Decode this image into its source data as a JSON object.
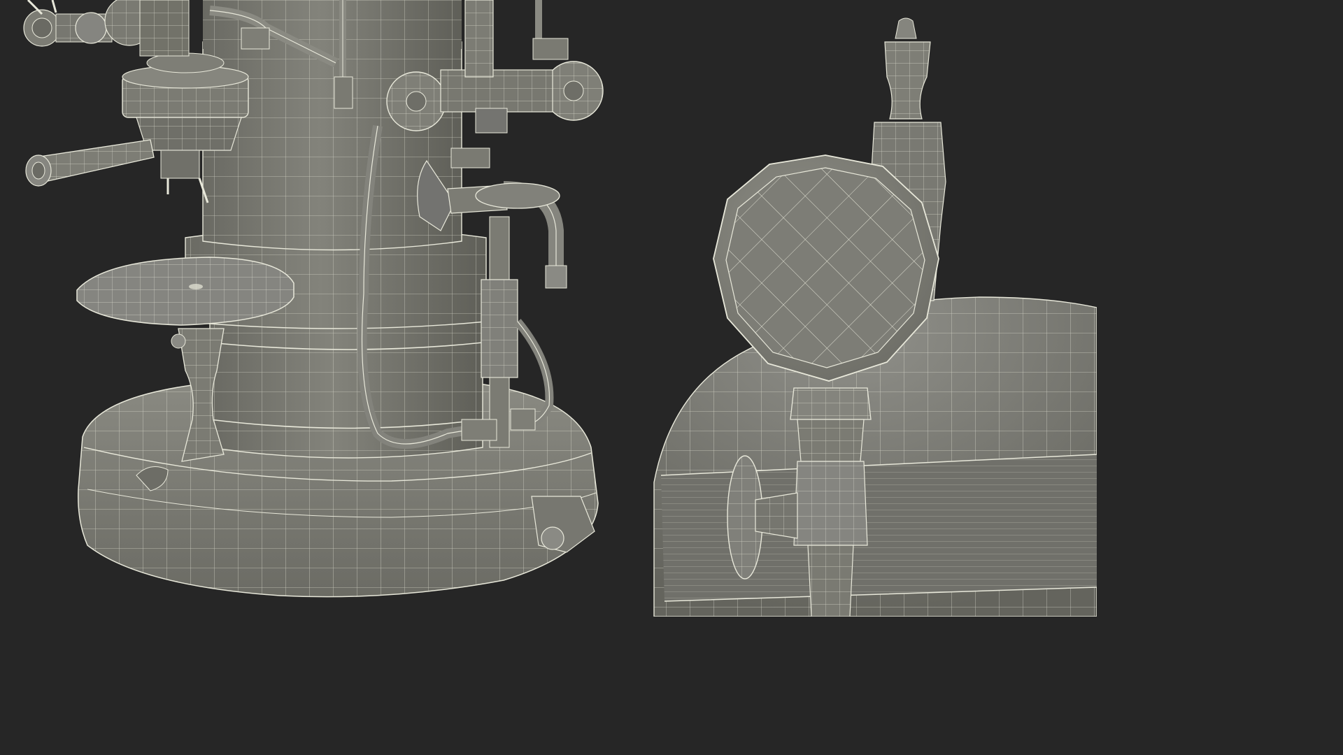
{
  "scene": {
    "background_color": "#262626",
    "surface_color": "#77776f",
    "wire_color": "#e8e8da",
    "shadow_color": "#5e5e57",
    "highlight_color": "#8f8f86"
  },
  "panels": [
    {
      "name": "espresso-machine-base-closeup"
    },
    {
      "name": "pressure-gauge-closeup"
    }
  ]
}
